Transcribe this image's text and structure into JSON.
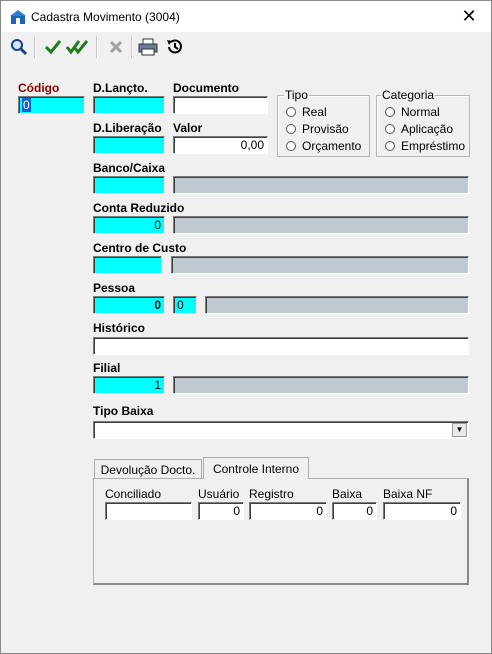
{
  "window": {
    "title": "Cadastra Movimento (3004)",
    "close_glyph": "✕"
  },
  "toolbar": {
    "search_icon": "search-icon",
    "confirm_icon": "check-icon",
    "confirm_all_icon": "double-check-icon",
    "cancel_icon": "x-icon",
    "print_icon": "printer-icon",
    "history_icon": "history-icon"
  },
  "form": {
    "codigo": {
      "label": "Código",
      "value": "0"
    },
    "d_lancto": {
      "label": "D.Lançto.",
      "value": ""
    },
    "documento": {
      "label": "Documento",
      "value": ""
    },
    "d_liberacao": {
      "label": "D.Liberação",
      "value": ""
    },
    "valor": {
      "label": "Valor",
      "value": "0,00"
    },
    "tipo": {
      "label": "Tipo",
      "options": [
        "Real",
        "Provisão",
        "Orçamento"
      ]
    },
    "categoria": {
      "label": "Categoria",
      "options": [
        "Normal",
        "Aplicação",
        "Empréstimo"
      ]
    },
    "banco_caixa": {
      "label": "Banco/Caixa",
      "value": "",
      "description": ""
    },
    "conta_reduzido": {
      "label": "Conta Reduzido",
      "value": "0",
      "description": ""
    },
    "centro_custo": {
      "label": "Centro de Custo",
      "value": "",
      "description": ""
    },
    "pessoa": {
      "label": "Pessoa",
      "value": "0",
      "sub_value": "0",
      "description": ""
    },
    "historico": {
      "label": "Histórico",
      "value": ""
    },
    "filial": {
      "label": "Filial",
      "value": "1",
      "description": ""
    },
    "tipo_baixa": {
      "label": "Tipo Baixa",
      "value": ""
    }
  },
  "tabs": {
    "items": [
      {
        "label": "Devolução Docto."
      },
      {
        "label": "Controle Interno"
      }
    ],
    "active": "Controle Interno",
    "controle_interno": {
      "conciliado": {
        "label": "Conciliado",
        "value": ""
      },
      "usuario": {
        "label": "Usuário",
        "value": "0"
      },
      "registro": {
        "label": "Registro",
        "value": "0"
      },
      "baixa": {
        "label": "Baixa",
        "value": "0"
      },
      "baixa_nf": {
        "label": "Baixa NF",
        "value": "0"
      }
    }
  },
  "colors": {
    "required_field": "#00ffff",
    "lookup_field": "#c0c8d0",
    "code_label": "#8b0000"
  }
}
